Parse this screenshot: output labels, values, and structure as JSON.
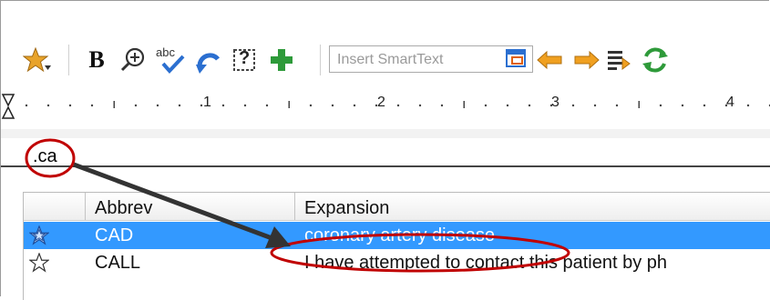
{
  "toolbar": {
    "buttons": [
      {
        "name": "favorites-star-icon"
      },
      {
        "name": "bold-icon",
        "label": "B"
      },
      {
        "name": "zoom-icon"
      },
      {
        "name": "spellcheck-icon",
        "label": "abc"
      },
      {
        "name": "undo-icon"
      },
      {
        "name": "help-icon",
        "label": "?"
      },
      {
        "name": "add-icon"
      },
      {
        "name": "insert-smarttext-icon"
      },
      {
        "name": "arrow-left-icon"
      },
      {
        "name": "arrow-right-icon"
      },
      {
        "name": "list-arrow-icon"
      },
      {
        "name": "refresh-icon"
      }
    ],
    "smarttext_placeholder": "Insert SmartText"
  },
  "ruler": {
    "marks": [
      "1",
      "2",
      "3",
      "4"
    ]
  },
  "editor": {
    "typed_text": ".ca"
  },
  "popup": {
    "columns": [
      "Abbrev",
      "Expansion"
    ],
    "rows": [
      {
        "abbrev": "CAD",
        "expansion": "coronary artery disease",
        "selected": true,
        "favorite": true
      },
      {
        "abbrev": "CALL",
        "expansion": "I have attempted to contact this patient by ph",
        "selected": false,
        "favorite": false
      }
    ]
  },
  "colors": {
    "selection": "#3399ff",
    "annotation": "#c00000",
    "arrow": "#333333",
    "accent_orange": "#f0a020",
    "accent_green": "#2e9a3a"
  }
}
